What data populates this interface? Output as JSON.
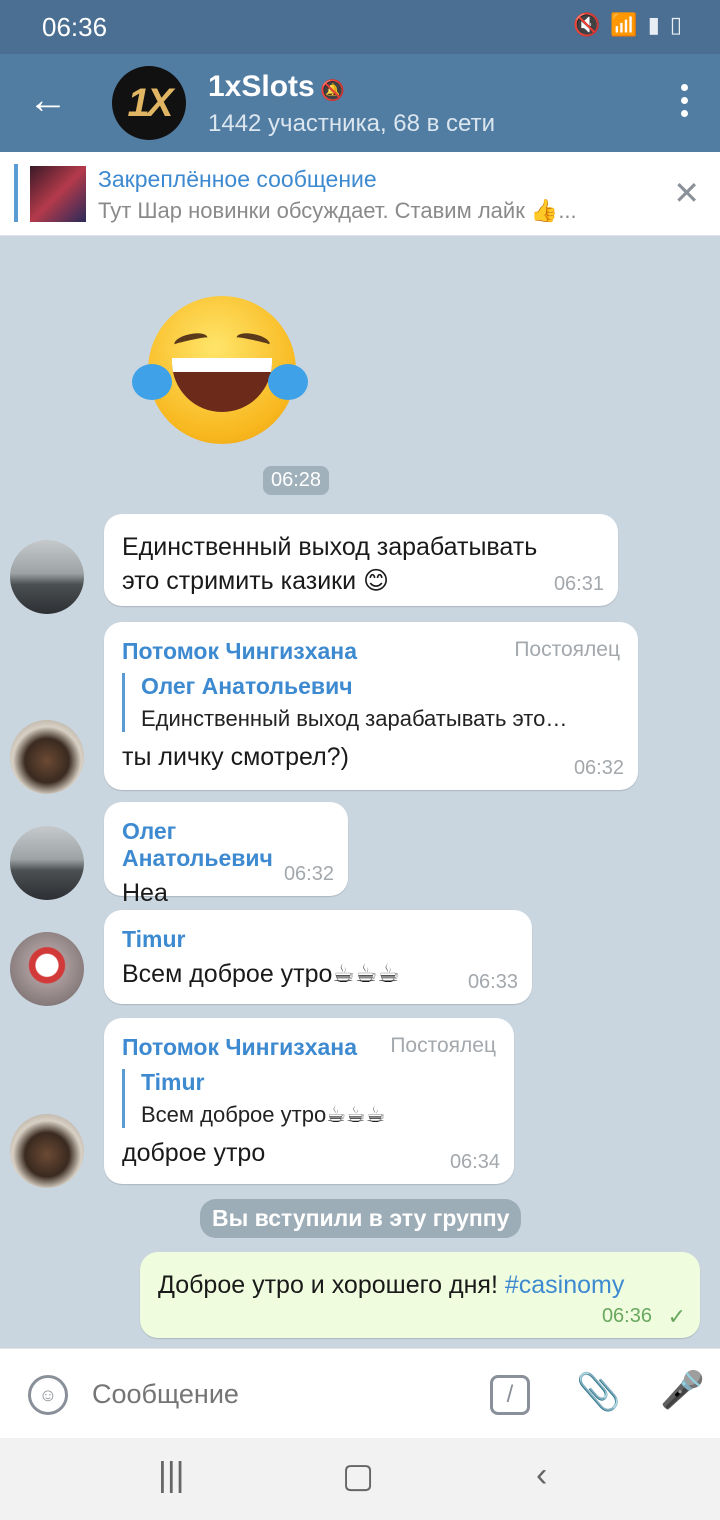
{
  "status_bar": {
    "time": "06:36"
  },
  "header": {
    "logo_text": "1X",
    "title": "1xSlots",
    "subtitle": "1442 участника, 68 в сети"
  },
  "pinned": {
    "title": "Закреплённое сообщение",
    "text": "Тут Шар новинки обсуждает. Ставим лайк 👍..."
  },
  "sticker_time": "06:28",
  "messages": [
    {
      "text": "Единственный выход зарабатывать это стримить казики 😊",
      "time": "06:31"
    },
    {
      "sender": "Потомок Чингизхана",
      "role": "Постоялец",
      "reply_name": "Олег Анатольевич",
      "reply_text": "Единственный выход зарабатывать это…",
      "text": "ты личку смотрел?)",
      "time": "06:32"
    },
    {
      "sender": "Олег Анатольевич",
      "text": "Неа",
      "time": "06:32"
    },
    {
      "sender": "Timur",
      "text": "Всем доброе утро☕☕☕",
      "time": "06:33"
    },
    {
      "sender": "Потомок Чингизхана",
      "role": "Постоялец",
      "reply_name": "Timur",
      "reply_text": "Всем доброе утро☕☕☕",
      "text": "доброе утро",
      "time": "06:34"
    },
    {
      "text": "Доброе утро и хорошего дня!",
      "hashtag": "#casinomy",
      "time": "06:36"
    }
  ],
  "service_message": "Вы вступили в эту группу",
  "input": {
    "placeholder": "Сообщение"
  },
  "colors": {
    "header": "#527da3",
    "accent": "#3d8ad0",
    "outgoing": "#effdde"
  }
}
